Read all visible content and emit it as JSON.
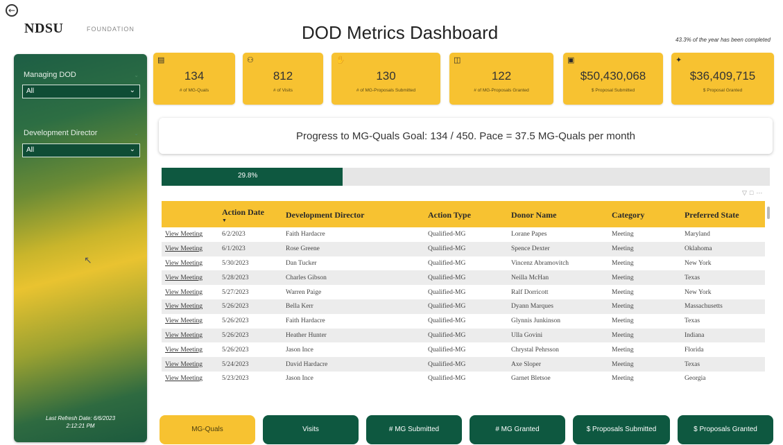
{
  "header": {
    "back_icon": "back-arrow-icon",
    "logo": "NDSU",
    "logo_sub": "FOUNDATION",
    "title": "DOD Metrics Dashboard",
    "year_note": "43.3% of the year has been completed"
  },
  "sidebar": {
    "filters": [
      {
        "label": "Managing DOD",
        "value": "All"
      },
      {
        "label": "Development Director",
        "value": "All"
      }
    ],
    "refresh_line1": "Last Refresh Date: 6/6/2023",
    "refresh_line2": "2:12:21 PM"
  },
  "kpis": [
    {
      "icon": "clipboard-icon",
      "value": "134",
      "label": "# of MG-Quals"
    },
    {
      "icon": "people-icon",
      "value": "812",
      "label": "# of Visits"
    },
    {
      "icon": "handshake-icon",
      "value": "130",
      "label": "# of MG-Proposals Submitted"
    },
    {
      "icon": "gift-icon",
      "value": "122",
      "label": "# of MG-Proposals Granted"
    },
    {
      "icon": "document-icon",
      "value": "$50,430,068",
      "label": "$ Proposal Submitted"
    },
    {
      "icon": "satellite-icon",
      "value": "$36,409,715",
      "label": "$ Proposal Granted"
    }
  ],
  "progress": {
    "text": "Progress to MG-Quals Goal: 134 / 450. Pace = 37.5 MG-Quals per month",
    "fraction": 0.298,
    "label": "29.8%"
  },
  "table": {
    "columns": [
      "",
      "Action Date",
      "Development Director",
      "Action Type",
      "Donor Name",
      "Category",
      "Preferred State"
    ],
    "rows": [
      [
        "View Meeting",
        "6/2/2023",
        "Faith Hardacre",
        "Qualified-MG",
        "Lorane Papes",
        "Meeting",
        "Maryland"
      ],
      [
        "View Meeting",
        "6/1/2023",
        "Rose Greene",
        "Qualified-MG",
        "Spence Dexter",
        "Meeting",
        "Oklahoma"
      ],
      [
        "View Meeting",
        "5/30/2023",
        "Dan Tucker",
        "Qualified-MG",
        "Vincenz Abramovitch",
        "Meeting",
        "New York"
      ],
      [
        "View Meeting",
        "5/28/2023",
        "Charles Gibson",
        "Qualified-MG",
        "Neilla McHan",
        "Meeting",
        "Texas"
      ],
      [
        "View Meeting",
        "5/27/2023",
        "Warren Paige",
        "Qualified-MG",
        "Ralf Dorricott",
        "Meeting",
        "New York"
      ],
      [
        "View Meeting",
        "5/26/2023",
        "Bella Kerr",
        "Qualified-MG",
        "Dyann Marques",
        "Meeting",
        "Massachusetts"
      ],
      [
        "View Meeting",
        "5/26/2023",
        "Faith Hardacre",
        "Qualified-MG",
        "Glynnis Junkinson",
        "Meeting",
        "Texas"
      ],
      [
        "View Meeting",
        "5/26/2023",
        "Heather Hunter",
        "Qualified-MG",
        "Ulla Govini",
        "Meeting",
        "Indiana"
      ],
      [
        "View Meeting",
        "5/26/2023",
        "Jason Ince",
        "Qualified-MG",
        "Chrystal Pehrsson",
        "Meeting",
        "Florida"
      ],
      [
        "View Meeting",
        "5/24/2023",
        "David Hardacre",
        "Qualified-MG",
        "Axe Sloper",
        "Meeting",
        "Texas"
      ],
      [
        "View Meeting",
        "5/23/2023",
        "Jason Ince",
        "Qualified-MG",
        "Garnet Bletsoe",
        "Meeting",
        "Georgia"
      ]
    ]
  },
  "tabs": [
    {
      "label": "MG-Quals",
      "active": true
    },
    {
      "label": "Visits",
      "active": false
    },
    {
      "label": "# MG Submitted",
      "active": false
    },
    {
      "label": "# MG Granted",
      "active": false
    },
    {
      "label": "$ Proposals Submitted",
      "active": false
    },
    {
      "label": "$ Proposals Granted",
      "active": false
    }
  ],
  "colors": {
    "accent_yellow": "#f7c231",
    "brand_green": "#0e5840",
    "track_gray": "#e6e6e6"
  }
}
